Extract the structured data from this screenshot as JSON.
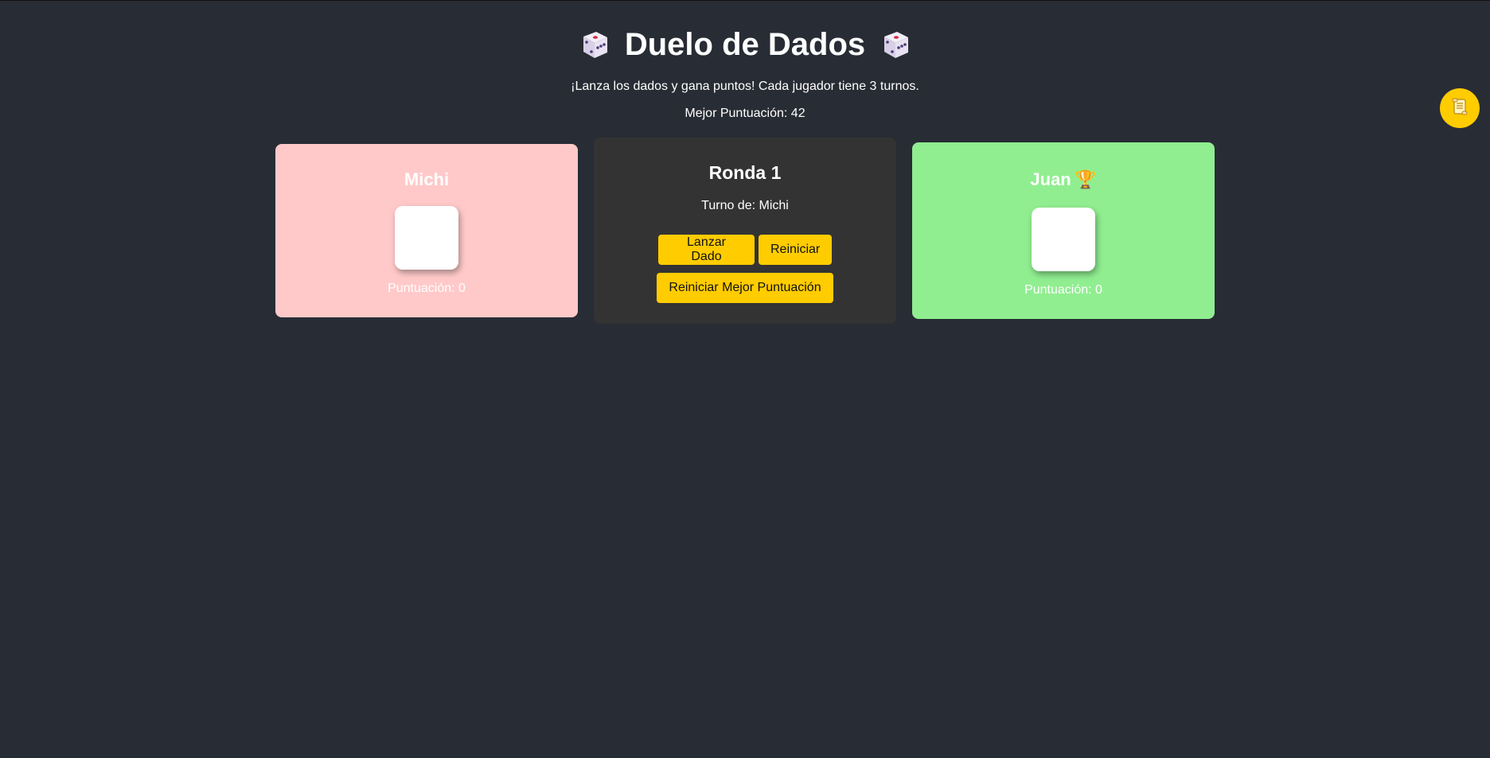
{
  "header": {
    "title": "Duelo de Dados",
    "subtitle": "¡Lanza los dados y gana puntos! Cada jugador tiene 3 turnos.",
    "best_score_text": "Mejor Puntuación: 42"
  },
  "players": [
    {
      "name": "Michi",
      "score_text": "Puntuación: 0",
      "color": "#ffc9c9"
    },
    {
      "name": "Juan",
      "trophy": "🏆",
      "score_text": "Puntuación: 0",
      "color": "#90ee90"
    }
  ],
  "center": {
    "round": "Ronda 1",
    "turn": "Turno de: Michi",
    "buttons": {
      "roll": "Lanzar Dado",
      "reset": "Reiniciar",
      "reset_best": "Reiniciar Mejor Puntuación"
    }
  },
  "icons": {
    "title_left": "die-icon",
    "title_right": "die-icon",
    "fab": "scroll-icon"
  },
  "colors": {
    "background": "#282c34",
    "accent": "#ffcc00",
    "center_card": "#333333"
  }
}
